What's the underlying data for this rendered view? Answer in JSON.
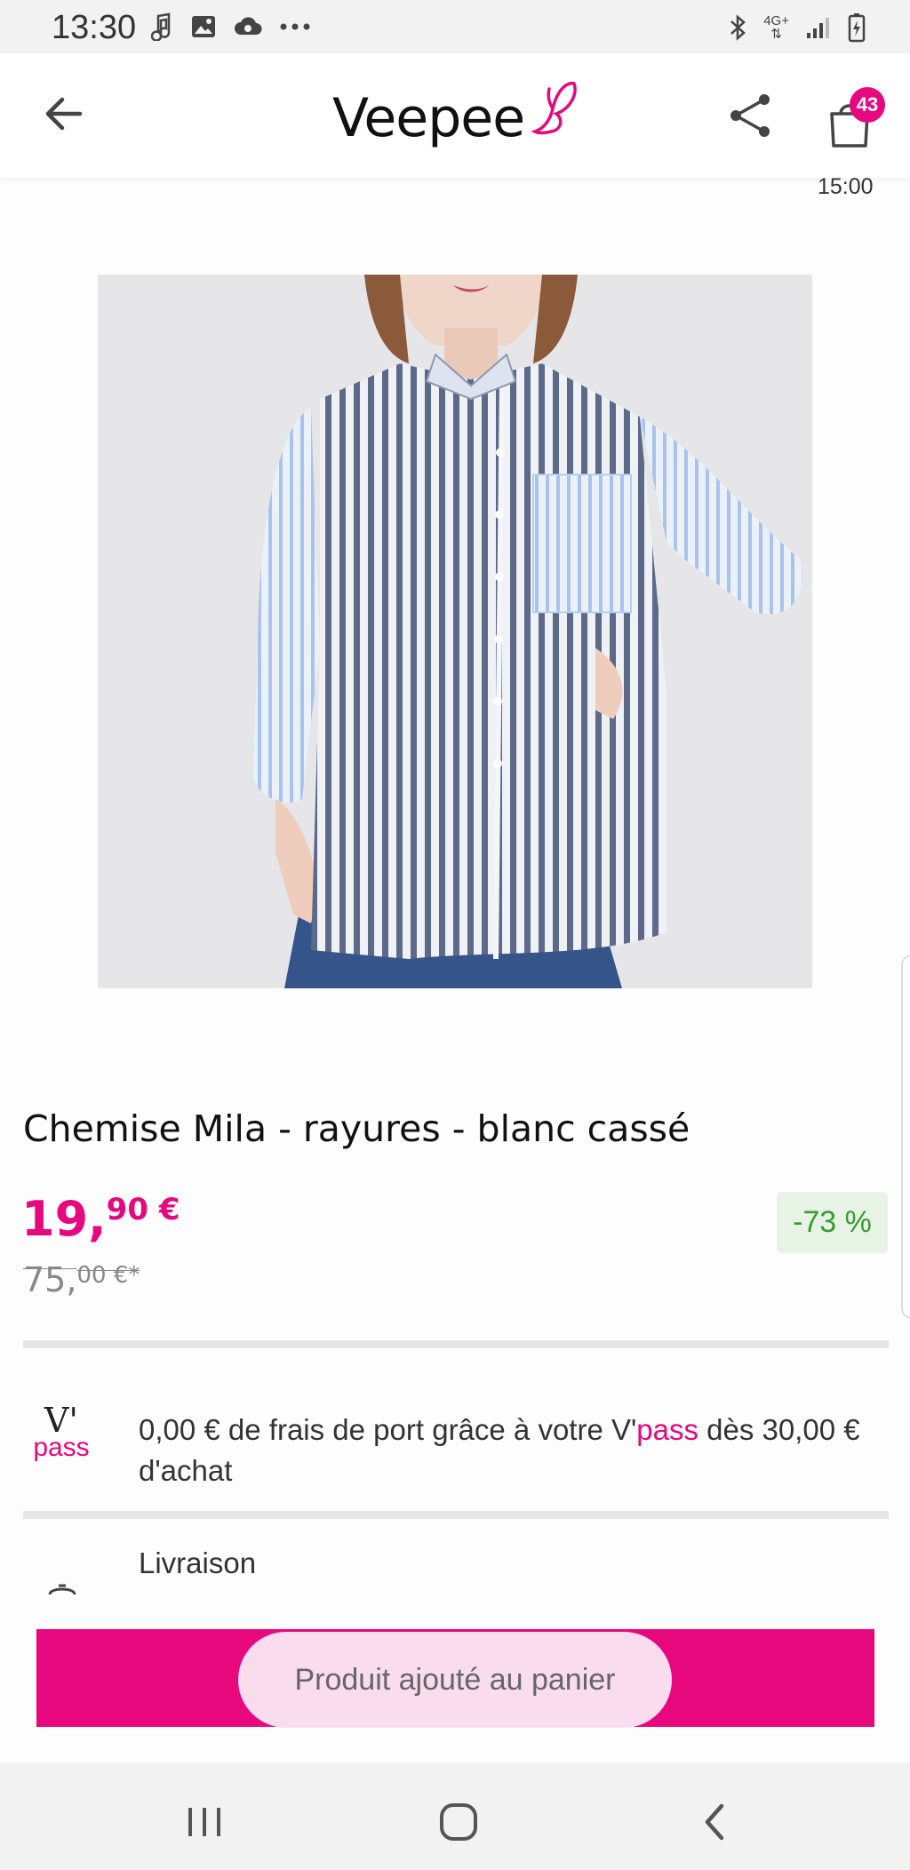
{
  "status_bar": {
    "time": "13:30",
    "network": "4G+"
  },
  "app_bar": {
    "logo_text": "Veepee",
    "cart_count": "43",
    "cart_timer": "15:00"
  },
  "product": {
    "title": "Chemise Mila - rayures - blanc cassé",
    "price_whole": "19,",
    "price_decimals": "90 €",
    "old_price_whole": "75,",
    "old_price_decimals": "00 €*",
    "discount": "-73 %",
    "image_alt": "striped shirt photo"
  },
  "shipping": {
    "vpass_v": "V'",
    "vpass_word": "pass",
    "text_before": "0,00 € de frais de port grâce à votre V'",
    "text_pink": "pass",
    "text_after": " dès 30,00 € d'achat"
  },
  "delivery": {
    "label": "Livraison"
  },
  "add_to_cart": {
    "toast": "Produit ajouté au panier"
  },
  "colors": {
    "brand_pink": "#e5087e",
    "discount_green": "#3a9a34",
    "discount_bg": "#e7f4e5"
  }
}
